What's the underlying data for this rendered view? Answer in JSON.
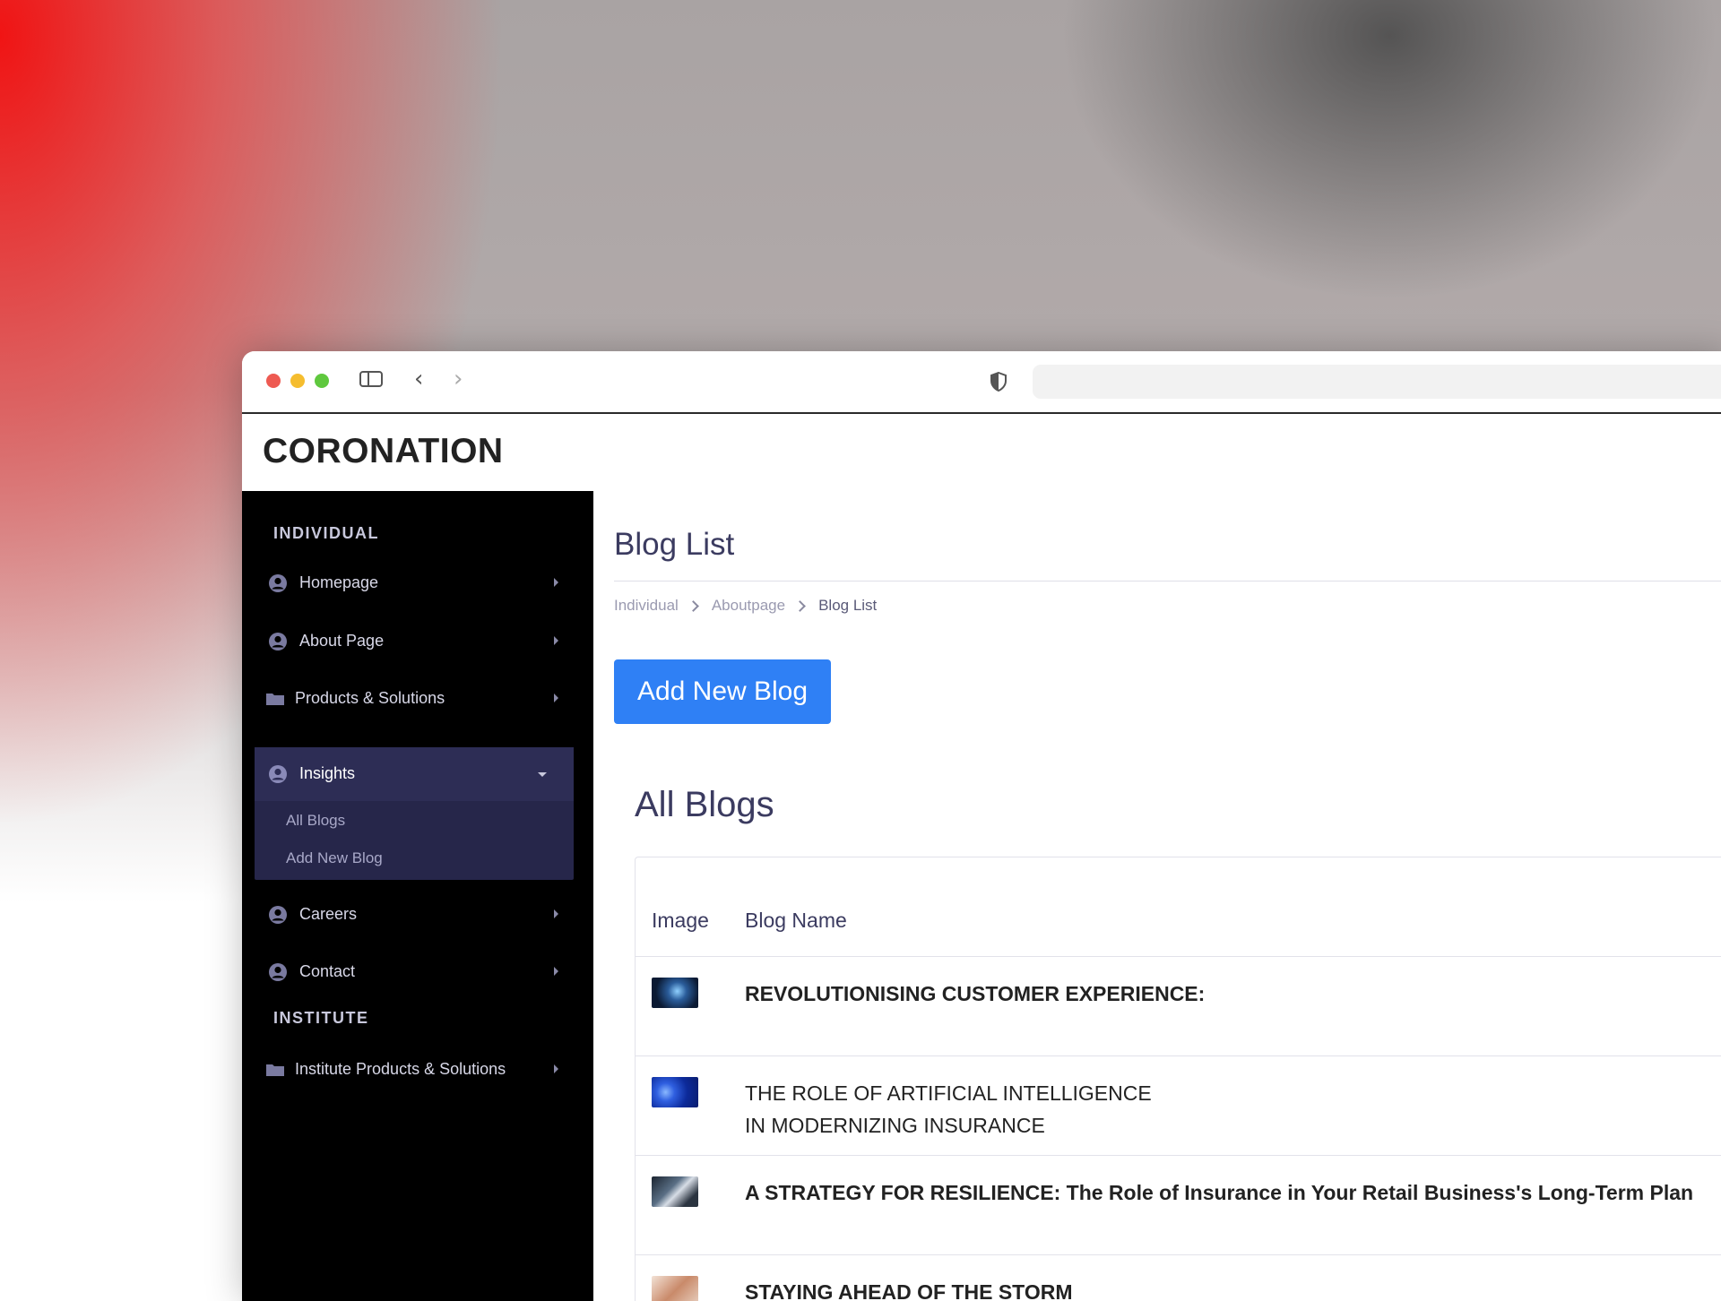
{
  "browser": {
    "back_icon": "chevron-left-icon",
    "forward_icon": "chevron-right-icon",
    "shield_icon": "shield-icon",
    "sidebar_icon": "sidebar-toggle-icon",
    "address": ""
  },
  "app": {
    "logo": "CORONATION"
  },
  "sidebar": {
    "sections": [
      {
        "title": "INDIVIDUAL"
      },
      {
        "title": "INSTITUTE"
      }
    ],
    "items": [
      {
        "label": "Homepage",
        "icon": "user-circle-icon"
      },
      {
        "label": "About Page",
        "icon": "user-circle-icon"
      },
      {
        "label": "Products & Solutions",
        "icon": "folder-icon"
      },
      {
        "label": "Insights",
        "icon": "user-circle-icon",
        "expanded": true,
        "children": [
          {
            "label": "All Blogs"
          },
          {
            "label": "Add New Blog"
          }
        ]
      },
      {
        "label": "Careers",
        "icon": "user-circle-icon"
      },
      {
        "label": "Contact",
        "icon": "user-circle-icon"
      },
      {
        "label": "Institute Products & Solutions",
        "icon": "folder-icon"
      }
    ]
  },
  "main": {
    "page_title": "Blog List",
    "breadcrumb": [
      "Individual",
      "Aboutpage",
      "Blog List"
    ],
    "add_button": "Add New Blog",
    "section_heading": "All Blogs",
    "table": {
      "columns": [
        "Image",
        "Blog Name"
      ],
      "rows": [
        {
          "title": "REVOLUTIONISING CUSTOMER EXPERIENCE:",
          "line2": "",
          "bold": true
        },
        {
          "title": "THE ROLE OF ARTIFICIAL INTELLIGENCE",
          "line2": "IN MODERNIZING INSURANCE",
          "bold": false
        },
        {
          "title": "A STRATEGY FOR RESILIENCE: The Role of Insurance in Your Retail Business's Long-Term Plan",
          "line2": "",
          "bold": true
        },
        {
          "title": "STAYING AHEAD OF THE STORM",
          "line2": "",
          "bold": true
        }
      ]
    }
  },
  "colors": {
    "accent": "#2f80f5",
    "sidebar_bg": "#000000",
    "sidebar_active": "#2d2d55",
    "text_dark": "#3b3b60"
  }
}
